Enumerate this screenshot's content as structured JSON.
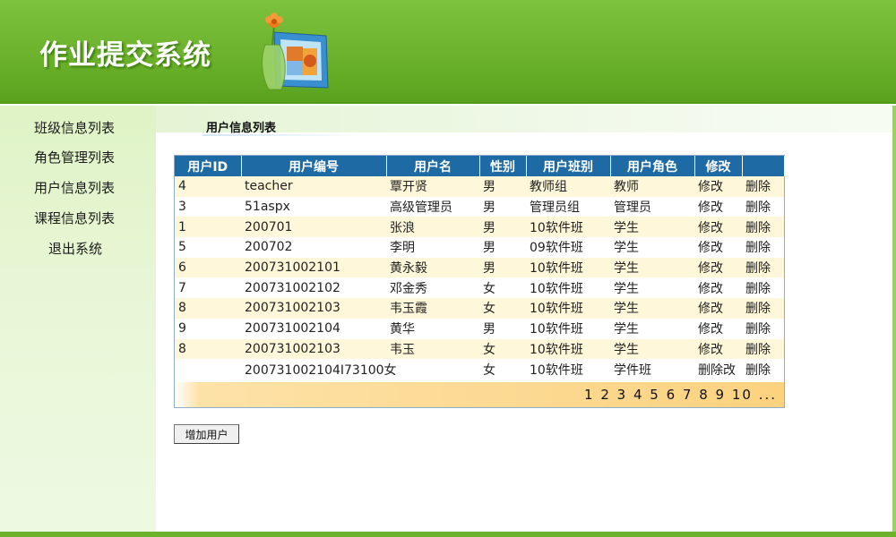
{
  "header": {
    "app_title": "作业提交系统"
  },
  "sidebar": {
    "items": [
      {
        "label": "班级信息列表"
      },
      {
        "label": "角色管理列表"
      },
      {
        "label": "用户信息列表"
      },
      {
        "label": "课程信息列表"
      },
      {
        "label": "退出系统"
      }
    ]
  },
  "main": {
    "section_title": "用户信息列表",
    "table": {
      "headers": [
        "用户ID",
        "用户编号",
        "用户名",
        "性别",
        "用户班别",
        "用户角色",
        "修改",
        ""
      ],
      "rows": [
        {
          "id": "4",
          "code": "teacher",
          "name": "覃开贤",
          "gender": "男",
          "class": "教师组",
          "role": "教师",
          "edit": "修改",
          "delete": "删除"
        },
        {
          "id": "3",
          "code": "51aspx",
          "name": "高级管理员",
          "gender": "男",
          "class": "管理员组",
          "role": "管理员",
          "edit": "修改",
          "delete": "删除"
        },
        {
          "id": "1",
          "code": "200701",
          "name": "张浪",
          "gender": "男",
          "class": "10软件班",
          "role": "学生",
          "edit": "修改",
          "delete": "删除"
        },
        {
          "id": "5",
          "code": "200702",
          "name": "李明",
          "gender": "男",
          "class": "09软件班",
          "role": "学生",
          "edit": "修改",
          "delete": "删除"
        },
        {
          "id": "6",
          "code": "200731002101",
          "name": "黄永毅",
          "gender": "男",
          "class": "10软件班",
          "role": "学生",
          "edit": "修改",
          "delete": "删除"
        },
        {
          "id": "7",
          "code": "200731002102",
          "name": "邓金秀",
          "gender": "女",
          "class": "10软件班",
          "role": "学生",
          "edit": "修改",
          "delete": "删除"
        },
        {
          "id": "8",
          "code": "200731002103",
          "name": "韦玉霞",
          "gender": "女",
          "class": "10软件班",
          "role": "学生",
          "edit": "修改",
          "delete": "删除"
        },
        {
          "id": "9",
          "code": "200731002104",
          "name": "黄华",
          "gender": "男",
          "class": "10软件班",
          "role": "学生",
          "edit": "修改",
          "delete": "删除"
        },
        {
          "id": "8",
          "code": "200731002103",
          "name": "韦玉",
          "gender": "女",
          "class": "10软件班",
          "role": "学生",
          "edit": "修改",
          "delete": "删除"
        },
        {
          "id": "",
          "code": "200731002104I73100女",
          "name": "",
          "gender": "女",
          "class": "10软件班",
          "role": "学件班",
          "edit": "删除改",
          "delete": "删除"
        }
      ]
    },
    "pager": "1 2 3 4 5 6 7 8 9 10 ...",
    "add_button_label": "增加用户"
  },
  "colors": {
    "header_green": "#6cb22c",
    "table_header_blue": "#1e6aa5",
    "row_alt_yellow": "#fff7d9",
    "pager_orange": "#fcd27f"
  }
}
